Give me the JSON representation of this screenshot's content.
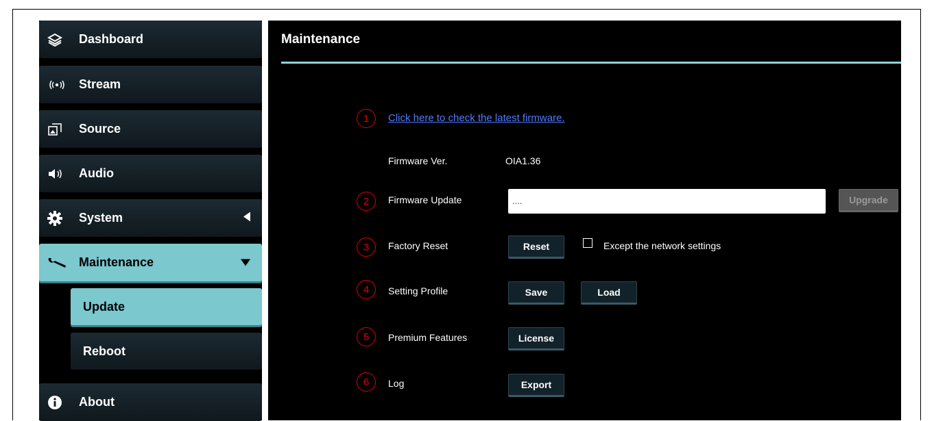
{
  "sidebar": {
    "items": [
      {
        "label": "Dashboard",
        "icon": "layers-icon"
      },
      {
        "label": "Stream",
        "icon": "broadcast-icon"
      },
      {
        "label": "Source",
        "icon": "source-icon"
      },
      {
        "label": "Audio",
        "icon": "speaker-icon"
      },
      {
        "label": "System",
        "icon": "gear-icon"
      },
      {
        "label": "Maintenance",
        "icon": "wrench-icon"
      },
      {
        "label": "About",
        "icon": "info-icon"
      }
    ],
    "sub_items": [
      {
        "label": "Update"
      },
      {
        "label": "Reboot"
      }
    ]
  },
  "main": {
    "title": "Maintenance",
    "markers": [
      "1",
      "2",
      "3",
      "4",
      "5",
      "6"
    ],
    "firmware_link": "Click here to check the latest firmware.",
    "firmware_ver_label": "Firmware Ver.",
    "firmware_ver_value": "OIA1.36",
    "firmware_update_label": "Firmware Update",
    "firmware_update_value": "....",
    "upgrade_label": "Upgrade",
    "factory_reset_label": "Factory Reset",
    "reset_label": "Reset",
    "except_network_label": "Except the network settings",
    "setting_profile_label": "Setting Profile",
    "save_label": "Save",
    "load_label": "Load",
    "premium_label": "Premium Features",
    "license_label": "License",
    "log_label": "Log",
    "export_label": "Export"
  },
  "colors": {
    "accent": "#7bc8cf",
    "link": "#4f7bff",
    "marker": "#e00000"
  }
}
